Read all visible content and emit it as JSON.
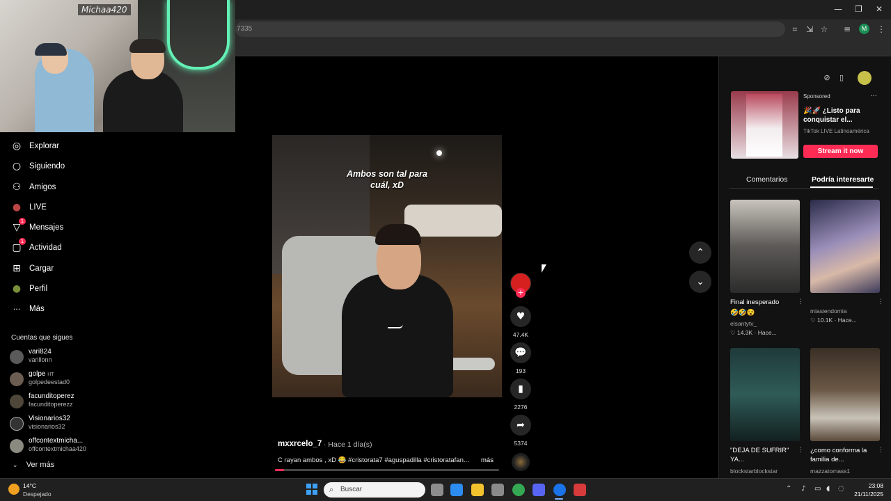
{
  "browser": {
    "url_fragment": "7335",
    "window_controls": [
      "—",
      "❐",
      "✕"
    ],
    "toolbar_icons": [
      "translate-icon",
      "install-icon",
      "bookmark-star-icon",
      "media-icon",
      "profile-icon",
      "menu-icon"
    ],
    "profile_initial": "M"
  },
  "webcam": {
    "tag": "Michaa420"
  },
  "sidebar": {
    "items": [
      {
        "label": "Explorar",
        "icon": "compass-icon",
        "glyph": "◎"
      },
      {
        "label": "Siguiendo",
        "icon": "following-icon",
        "glyph": "○"
      },
      {
        "label": "Amigos",
        "icon": "friends-icon",
        "glyph": "⚇"
      },
      {
        "label": "LIVE",
        "icon": "live-icon",
        "glyph": "●"
      },
      {
        "label": "Mensajes",
        "icon": "messages-icon",
        "glyph": "▽",
        "badge": "1"
      },
      {
        "label": "Actividad",
        "icon": "activity-icon",
        "glyph": "▢",
        "badge": "1"
      },
      {
        "label": "Cargar",
        "icon": "upload-icon",
        "glyph": "⊞"
      },
      {
        "label": "Perfil",
        "icon": "profile-icon",
        "glyph": "●"
      },
      {
        "label": "Más",
        "icon": "more-icon",
        "glyph": "···"
      }
    ],
    "following_title": "Cuentas que sigues",
    "accounts": [
      {
        "name": "vari824",
        "handle": "varillonn"
      },
      {
        "name": "golpe",
        "badge": "HT",
        "handle": "golpedeestad0"
      },
      {
        "name": "facunditoperez",
        "handle": "facunditoperezz"
      },
      {
        "name": "Visionarios32",
        "handle": "visionarios32"
      },
      {
        "name": "offcontextmicha...",
        "handle": "offcontextmichaa420"
      }
    ],
    "see_more": "Ver más"
  },
  "video": {
    "overlay_text": [
      "Ambos son tal para",
      "cuál, xD"
    ],
    "author": "mxxrcelo_7",
    "time": "· Hace 1 día(s)",
    "description": "C rayan ambos , xD 😂 #cristorata7 #aguspadilla #cristoratafan...",
    "more": "más",
    "progress": 0.04
  },
  "actions": {
    "likes": "47.4K",
    "comments": "193",
    "saves": "2276",
    "shares": "5374"
  },
  "right_panel": {
    "ad": {
      "label": "Sponsored",
      "title": "🎉🚀 ¿Listo para conquistar el...",
      "source": "TikTok LIVE Latinoamérica",
      "cta": "Stream it now"
    },
    "tabs": [
      "Comentarios",
      "Podría interesarte"
    ],
    "cards": [
      {
        "title": "Final inesperado",
        "emojis": "🤣🤣😵",
        "author": "elsantytv_",
        "stats": "♡ 14.3K · Hace..."
      },
      {
        "title": "",
        "emojis": "",
        "author": "miasiendomia",
        "stats": "♡ 10.1K · Hace..."
      },
      {
        "title": "\"DEJA DE SUFRIR\" YA...",
        "emojis": "",
        "author": "blockstarblockstar",
        "stats": ""
      },
      {
        "title": "¿como conforma la familia de...",
        "emojis": "",
        "author": "mazzatomass1",
        "stats": ""
      }
    ]
  },
  "taskbar": {
    "weather_temp": "14°C",
    "weather_desc": "Despejado",
    "search_placeholder": "Buscar",
    "time": "23:08",
    "date": "21/11/2025",
    "app_colors": [
      "#8d8d8d",
      "#2d8cf0",
      "#f2c12e",
      "#8a8a8a",
      "#35a853",
      "#5865f2",
      "#1a73e8",
      "#d83b3b"
    ]
  },
  "colors": {
    "accent": "#fe2c55",
    "background": "#000000",
    "panel": "#121212"
  }
}
